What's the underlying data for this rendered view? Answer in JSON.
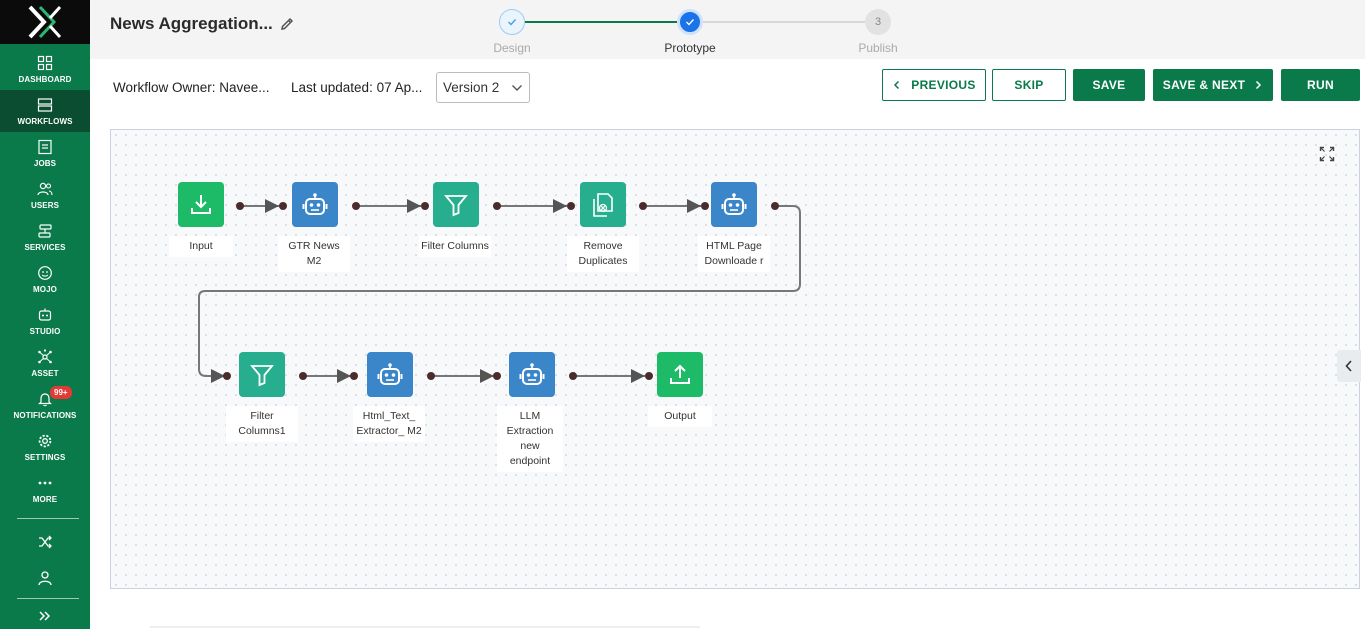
{
  "sidebar": {
    "items": [
      {
        "label": "DASHBOARD",
        "icon": "dashboard-icon"
      },
      {
        "label": "WORKFLOWS",
        "icon": "workflows-icon"
      },
      {
        "label": "JOBS",
        "icon": "jobs-icon"
      },
      {
        "label": "USERS",
        "icon": "users-icon"
      },
      {
        "label": "SERVICES",
        "icon": "services-icon"
      },
      {
        "label": "MOJO",
        "icon": "mojo-icon"
      },
      {
        "label": "STUDIO",
        "icon": "studio-icon"
      },
      {
        "label": "ASSET",
        "icon": "asset-icon"
      },
      {
        "label": "NOTIFICATIONS",
        "icon": "bell-icon"
      },
      {
        "label": "SETTINGS",
        "icon": "gear-icon"
      },
      {
        "label": "MORE",
        "icon": "more-icon"
      }
    ],
    "active": "WORKFLOWS",
    "notification_badge": "99+"
  },
  "header": {
    "title": "News Aggregation...",
    "steps": [
      {
        "num": "",
        "label": "Design",
        "state": "done"
      },
      {
        "num": "",
        "label": "Prototype",
        "state": "current"
      },
      {
        "num": "3",
        "label": "Publish",
        "state": "pending"
      }
    ]
  },
  "toolbar": {
    "owner": "Workflow Owner: Navee...",
    "last_updated": "Last updated: 07 Ap...",
    "version": "Version 2",
    "previous_label": "PREVIOUS",
    "skip_label": "SKIP",
    "save_label": "SAVE",
    "save_next_label": "SAVE & NEXT",
    "run_label": "RUN"
  },
  "workflow": {
    "nodes": [
      {
        "label": "Input",
        "kind": "input"
      },
      {
        "label": "GTR News M2",
        "kind": "bot"
      },
      {
        "label": "Filter Columns",
        "kind": "filter"
      },
      {
        "label": "Remove Duplicates",
        "kind": "dedupe"
      },
      {
        "label": "HTML Page Downloade r",
        "kind": "bot"
      },
      {
        "label": "Filter Columns1",
        "kind": "filter"
      },
      {
        "label": "Html_Text_ Extractor_ M2",
        "kind": "bot"
      },
      {
        "label": "LLM Extraction new endpoint",
        "kind": "bot"
      },
      {
        "label": "Output",
        "kind": "output"
      }
    ]
  },
  "colors": {
    "brand": "#0a7a4a",
    "active_nav": "#0b4d31",
    "step_active": "#1a73e8",
    "node_green": "#1dbb68",
    "node_blue": "#3a86c8",
    "node_teal": "#27ae8f"
  }
}
